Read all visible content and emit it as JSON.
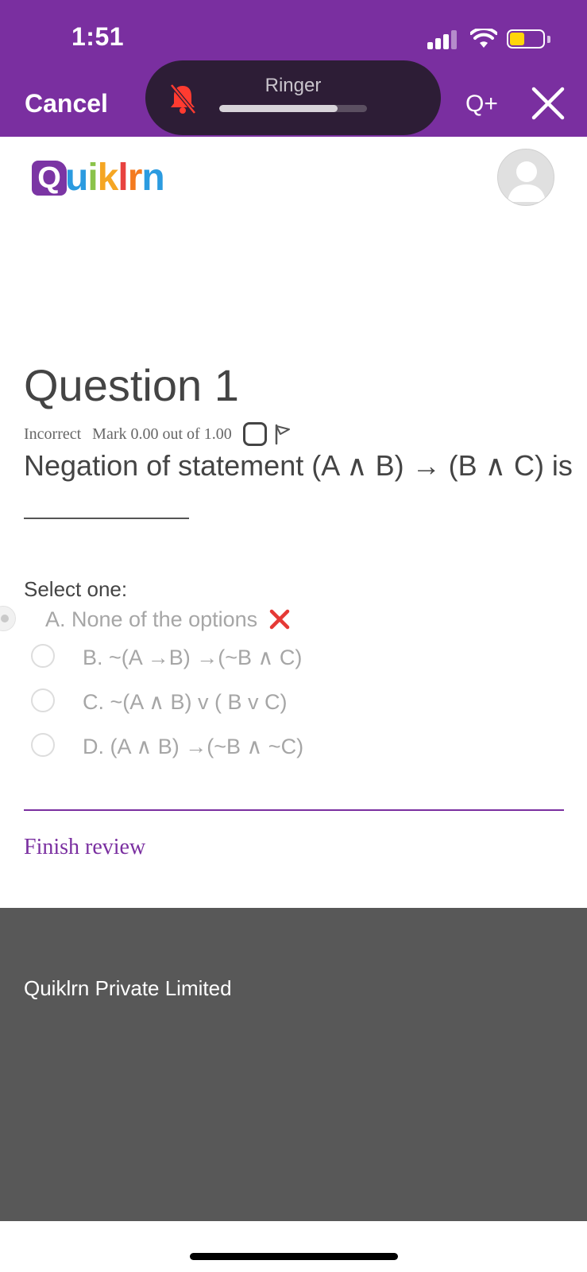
{
  "status_bar": {
    "time": "1:51",
    "battery_color": "#ffd60a"
  },
  "toolbar": {
    "cancel_label": "Cancel",
    "qplus_label": "Q+",
    "close_icon": "close-icon"
  },
  "ringer": {
    "label": "Ringer",
    "icon": "bell-slash-icon",
    "icon_color": "#ff3b30",
    "volume_percent": 80
  },
  "site": {
    "logo_letter": "Q",
    "logo_text": "uiklrn",
    "logo_colors": [
      "#7b35a4",
      "#2b9be0",
      "#8bc34a",
      "#f5a623",
      "#e8423f",
      "#f47a1f"
    ]
  },
  "question": {
    "title": "Question 1",
    "status": "Incorrect",
    "mark": "Mark 0.00 out of 1.00",
    "text": "Negation of statement (A ∧ B) → (B ∧ C) is",
    "select_label": "Select one:",
    "options": [
      {
        "label": "A. None of the options",
        "selected": true,
        "result": "incorrect"
      },
      {
        "label": "B. ~(A →B) →(~B ∧ C)",
        "selected": false
      },
      {
        "label": "C. ~(A ∧ B) v ( B v C)",
        "selected": false
      },
      {
        "label": "D. (A ∧ B) →(~B ∧ ~C)",
        "selected": false
      }
    ]
  },
  "actions": {
    "finish_review": "Finish review"
  },
  "footer": {
    "company": "Quiklrn Private Limited"
  },
  "colors": {
    "accent": "#7a2fa0",
    "footer_bg": "#585858",
    "incorrect": "#e53935"
  }
}
